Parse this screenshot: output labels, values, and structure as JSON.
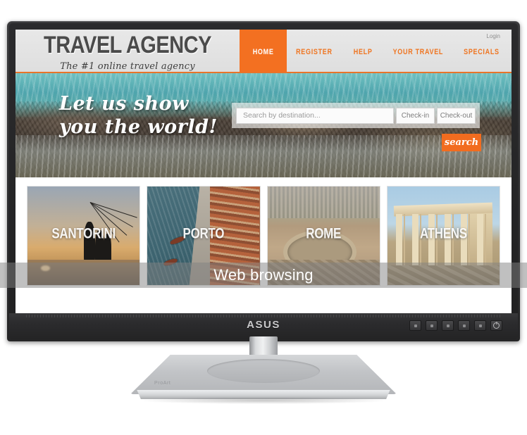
{
  "overlay": {
    "caption": "Web browsing"
  },
  "monitor": {
    "brand_logo": "ASUS",
    "stand_brand": "ProArt",
    "controls": [
      {
        "name": "menu-button",
        "icon": "square-dot-icon"
      },
      {
        "name": "control-button-2",
        "icon": "square-dot-icon"
      },
      {
        "name": "control-button-3",
        "icon": "square-dot-icon"
      },
      {
        "name": "control-button-4",
        "icon": "square-dot-icon"
      },
      {
        "name": "control-button-5",
        "icon": "square-dot-icon"
      },
      {
        "name": "power-button",
        "icon": "power-icon"
      }
    ]
  },
  "site": {
    "brand": {
      "title": "TRAVEL AGENCY",
      "tagline": "The #1 online travel agency"
    },
    "login_label": "Login",
    "nav": [
      {
        "label": "HOME",
        "active": true
      },
      {
        "label": "REGISTER",
        "active": false
      },
      {
        "label": "HELP",
        "active": false
      },
      {
        "label": "YOUR TRAVEL",
        "active": false
      },
      {
        "label": "SPECIALS",
        "active": false
      }
    ],
    "hero": {
      "line1": "Let us show",
      "line2": "you the world!"
    },
    "search": {
      "destination_placeholder": "Search by destination...",
      "destination_value": "",
      "checkin_label": "Check-in",
      "checkout_label": "Check-out",
      "button_label": "search"
    },
    "destinations": [
      {
        "label": "SANTORINI"
      },
      {
        "label": "PORTO"
      },
      {
        "label": "ROME"
      },
      {
        "label": "ATHENS"
      }
    ],
    "colors": {
      "accent_orange": "#f37021",
      "nav_orange": "#ef7521",
      "header_gray": "#e4e4e4"
    }
  }
}
